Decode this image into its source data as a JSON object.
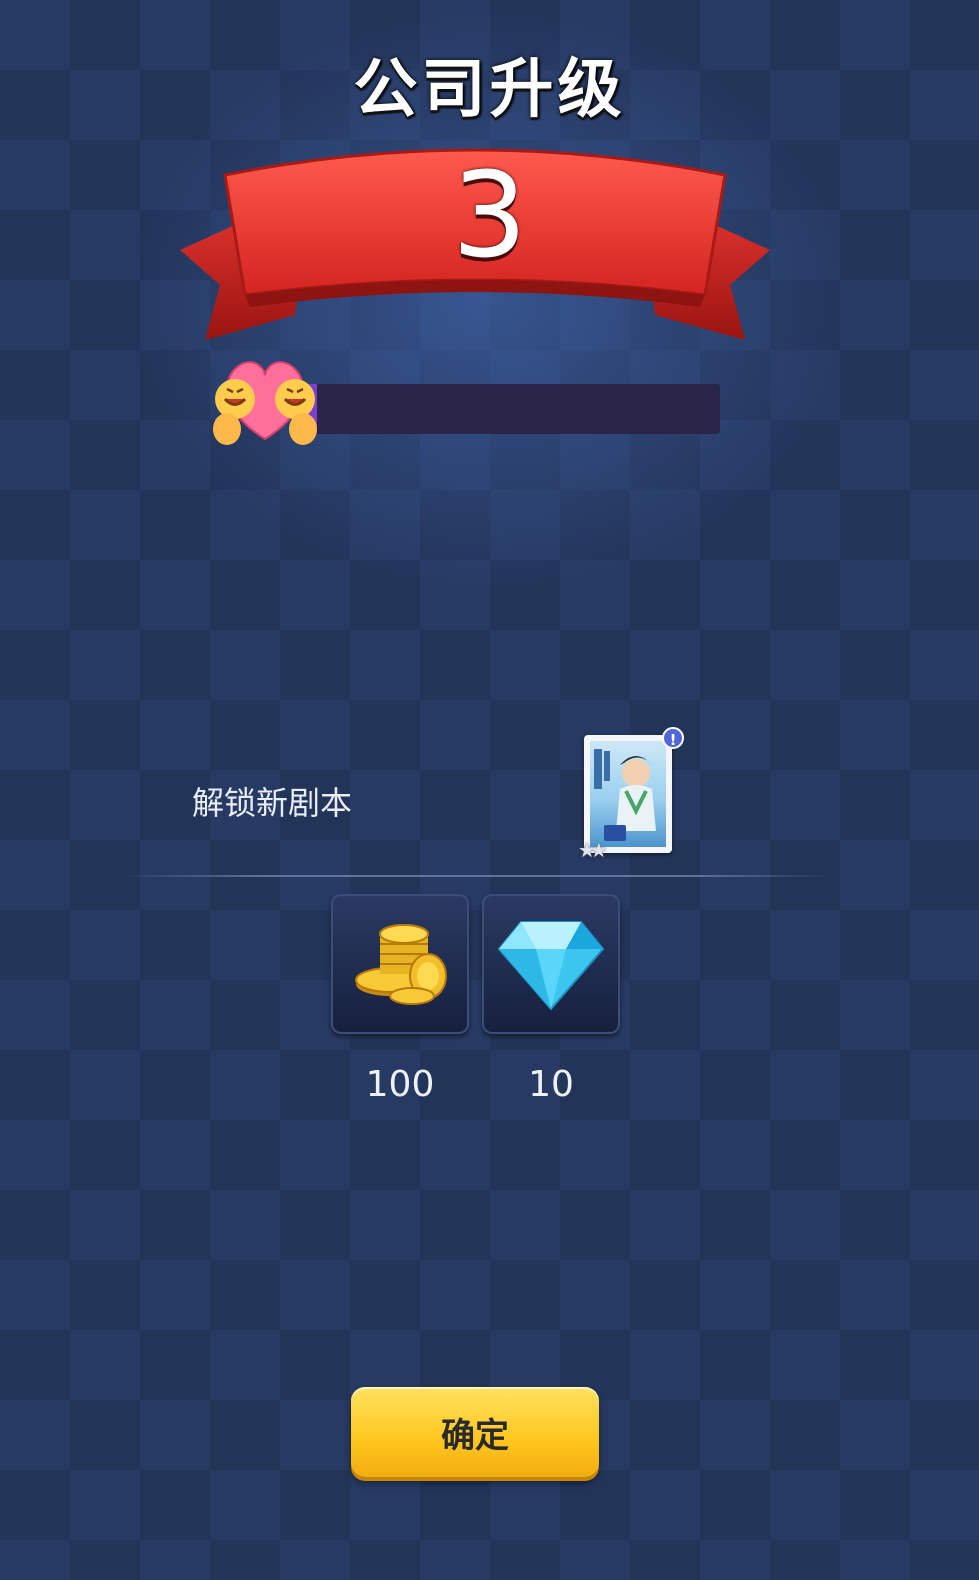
{
  "header": {
    "title": "公司升级"
  },
  "level": {
    "value": "3",
    "progress_fraction": 0.04
  },
  "unlock": {
    "label": "解锁新剧本",
    "badge": "!",
    "card_icon": "script-card-icon",
    "stars": "★★"
  },
  "rewards": [
    {
      "icon": "gold-coins-icon",
      "amount": "100"
    },
    {
      "icon": "diamond-icon",
      "amount": "10"
    }
  ],
  "actions": {
    "confirm_label": "确定"
  },
  "colors": {
    "ribbon": "#e8312f",
    "button": "#ffc61e",
    "progress_track": "#2a2548",
    "background": "#273a63"
  }
}
